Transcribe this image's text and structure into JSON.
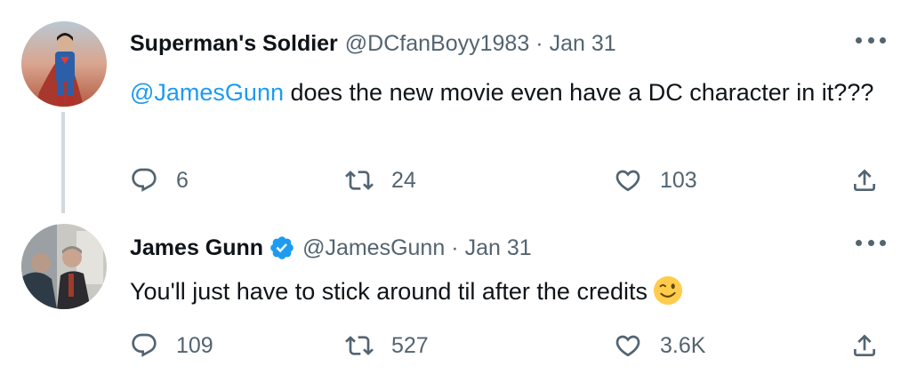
{
  "tweets": [
    {
      "display_name": "Superman's Soldier",
      "handle": "@DCfanBoyy1983",
      "separator": "·",
      "date": "Jan 31",
      "verified": false,
      "mention": "@JamesGunn",
      "text": " does the new movie even have a DC character in it???",
      "replies": "6",
      "retweets": "24",
      "likes": "103"
    },
    {
      "display_name": "James Gunn",
      "handle": "@JamesGunn",
      "separator": "·",
      "date": "Jan 31",
      "verified": true,
      "text": "You'll just have to stick around til after the credits",
      "emoji": "winking-face-emoji",
      "replies": "109",
      "retweets": "527",
      "likes": "3.6K"
    }
  ],
  "icons": {
    "reply": "reply-icon",
    "retweet": "retweet-icon",
    "like": "heart-icon",
    "share": "share-icon",
    "more": "more-options-icon",
    "verified": "verified-badge-icon"
  },
  "colors": {
    "link": "#1d9bf0",
    "secondary_text": "#536471",
    "primary_text": "#0f1419",
    "thread_line": "#cfd9de"
  }
}
